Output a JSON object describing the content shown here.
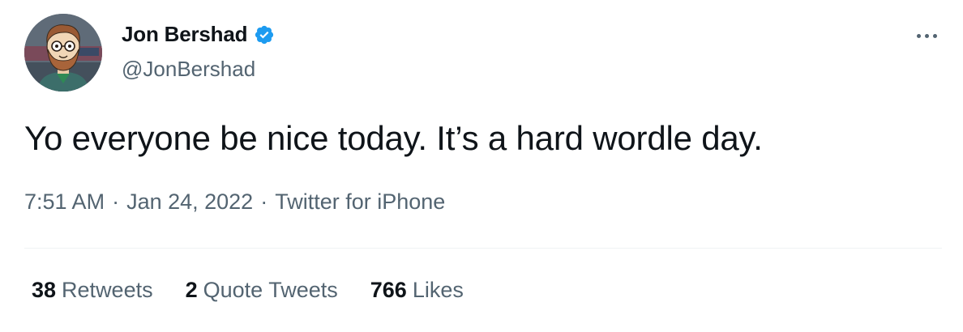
{
  "author": {
    "display_name": "Jon Bershad",
    "handle": "@JonBershad",
    "verified": true,
    "avatar_icon": "cartoon-bearded-man-avatar"
  },
  "tweet": {
    "text": "Yo everyone be nice today. It’s a hard wordle day.",
    "time": "7:51 AM",
    "date": "Jan 24, 2022",
    "source": "Twitter for iPhone",
    "separator": "·"
  },
  "stats": {
    "retweets": {
      "count": "38",
      "label": "Retweets"
    },
    "quote_tweets": {
      "count": "2",
      "label": "Quote Tweets"
    },
    "likes": {
      "count": "766",
      "label": "Likes"
    }
  },
  "colors": {
    "text_primary": "#0f1419",
    "text_secondary": "#536471",
    "verified_blue": "#1d9bf0",
    "divider": "#eff3f4"
  }
}
